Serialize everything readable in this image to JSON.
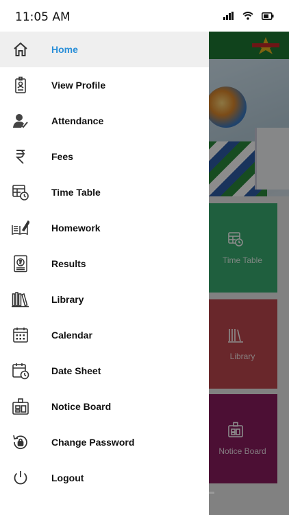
{
  "status_bar": {
    "time": "11:05 AM"
  },
  "background_tiles": [
    {
      "label": "Time Table",
      "color": "#3aae71"
    },
    {
      "label": "Library",
      "color": "#c0484f"
    },
    {
      "label": "Notice Board",
      "color": "#8a1c5f"
    }
  ],
  "menu": {
    "items": [
      {
        "label": "Home",
        "icon": "home-icon",
        "active": true
      },
      {
        "label": "View Profile",
        "icon": "id-card-icon"
      },
      {
        "label": "Attendance",
        "icon": "person-check-icon"
      },
      {
        "label": "Fees",
        "icon": "rupee-icon"
      },
      {
        "label": "Time Table",
        "icon": "timetable-icon"
      },
      {
        "label": "Homework",
        "icon": "book-pen-icon"
      },
      {
        "label": "Results",
        "icon": "result-icon"
      },
      {
        "label": "Library",
        "icon": "books-icon"
      },
      {
        "label": "Calendar",
        "icon": "calendar-icon"
      },
      {
        "label": "Date Sheet",
        "icon": "date-sheet-icon"
      },
      {
        "label": "Notice Board",
        "icon": "notice-board-icon"
      },
      {
        "label": "Change Password",
        "icon": "lock-reset-icon"
      },
      {
        "label": "Logout",
        "icon": "power-icon"
      }
    ]
  },
  "colors": {
    "active_text": "#2a8fd8",
    "header_green": "#1e7a33"
  }
}
